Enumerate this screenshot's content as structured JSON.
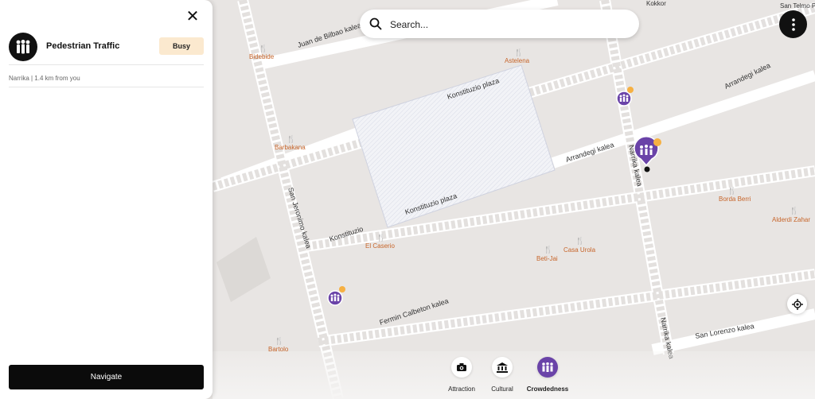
{
  "panel": {
    "close_symbol": "✕",
    "title": "Pedestrian Traffic",
    "status": "Busy",
    "location": "Narrika | 1.4 km from you",
    "navigate_label": "Navigate"
  },
  "search": {
    "placeholder": "Search..."
  },
  "categories": [
    {
      "label": "Attraction",
      "icon": "camera-icon"
    },
    {
      "label": "Cultural",
      "icon": "museum-icon"
    },
    {
      "label": "Crowdedness",
      "icon": "people-icon",
      "active": true
    }
  ],
  "map": {
    "streets": {
      "juan_de_bilbao": "Juan de Bilbao kalea",
      "konstituzio_plaza_top": "Konstituzio plaza",
      "konstituzio_plaza_bottom": "Konstituzio plaza",
      "arrandegi_right": "Arrandegi kalea",
      "arrandegi_mid": "Arrandegi kalea",
      "narrika": "Narrika kalea",
      "narrika_lower": "Narrika kalea",
      "san_jeronimo": "San Jeronimo kalea",
      "konstituzio": "Konstituzio",
      "fermin_calbeton": "Fermin Calbeton kalea",
      "san_lorenzo": "San Lorenzo kalea"
    },
    "places": {
      "bidebide": "Bidebide",
      "astelena": "Astelena",
      "barbakana": "Barbakana",
      "el_caserio": "El Caserio",
      "beti_jai": "Beti-Jai",
      "casa_urola": "Casa Urola",
      "borda_berri": "Borda Berri",
      "alderdi_zahar": "Alderdi Zahar",
      "bartolo": "Bartolo",
      "kokkor": "Kokkor",
      "san_telmo": "San Telmo P"
    },
    "colors": {
      "street": "#ffffff",
      "block": "#e8e5e3",
      "plaza": "#f1f2f6",
      "poi": "#c7652a",
      "crowd": "#6a43a8",
      "crowd_badge": "#f6b042"
    }
  }
}
